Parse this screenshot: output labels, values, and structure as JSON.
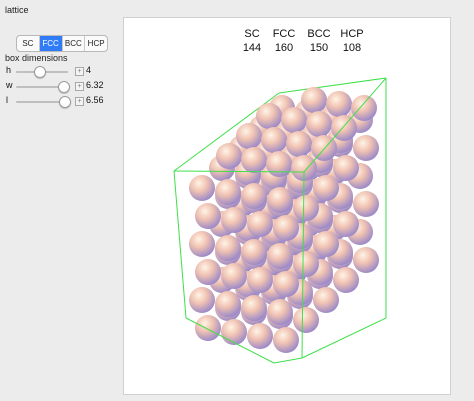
{
  "controls": {
    "lattice_label": "lattice",
    "lattice_options": [
      "SC",
      "FCC",
      "BCC",
      "HCP"
    ],
    "lattice_selected": "FCC",
    "box_label": "box dimensions",
    "sliders": [
      {
        "label": "h",
        "value": "4",
        "fraction": 0.45
      },
      {
        "label": "w",
        "value": "6.32",
        "fraction": 0.9
      },
      {
        "label": "l",
        "value": "6.56",
        "fraction": 0.93
      }
    ],
    "plus_glyph": "+"
  },
  "counts": {
    "headers": [
      "SC",
      "FCC",
      "BCC",
      "HCP"
    ],
    "values": [
      "144",
      "160",
      "150",
      "108"
    ]
  },
  "colors": {
    "accent": "#2f7cf6",
    "box_edge": "#3fe04a",
    "sphere_light": "#fff4e6",
    "sphere_mid": "#f0c2b2",
    "sphere_dark": "#9a88c8"
  }
}
